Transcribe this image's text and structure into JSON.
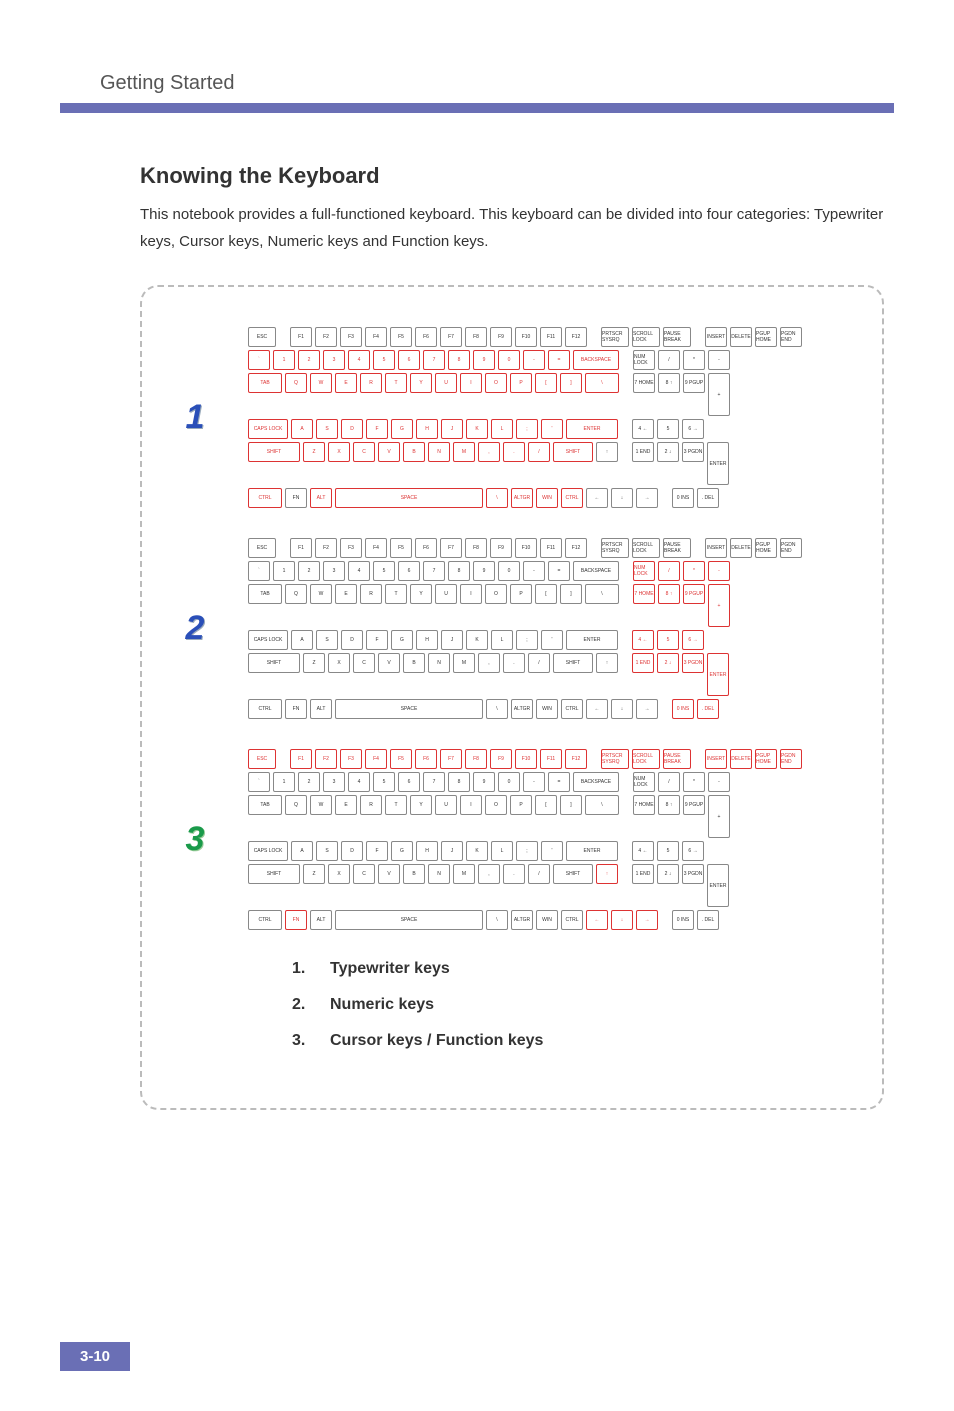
{
  "header": {
    "title": "Getting Started"
  },
  "section": {
    "title": "Knowing the Keyboard",
    "intro": "This notebook provides a full-functioned keyboard.    This keyboard can be divided into four categories: Typewriter keys, Cursor keys, Numeric keys and Function keys."
  },
  "diagrams": [
    {
      "number": "1",
      "color": "n1",
      "highlight": "typewriter"
    },
    {
      "number": "2",
      "color": "n2",
      "highlight": "numeric"
    },
    {
      "number": "3",
      "color": "n3",
      "highlight": "cursor_function"
    }
  ],
  "legend": [
    {
      "n": "1.",
      "label": "Typewriter keys"
    },
    {
      "n": "2.",
      "label": "Numeric keys"
    },
    {
      "n": "3.",
      "label": "Cursor keys / Function keys"
    }
  ],
  "keys": {
    "row_fn": [
      "ESC",
      "F1",
      "F2",
      "F3",
      "F4",
      "F5",
      "F6",
      "F7",
      "F8",
      "F9",
      "F10",
      "F11",
      "F12",
      "PRTSCR SYSRQ",
      "SCROLL LOCK",
      "PAUSE BREAK"
    ],
    "row_fn_right": [
      "INSERT",
      "DELETE",
      "PGUP HOME",
      "PGDN END"
    ],
    "row_num": [
      "`",
      "1",
      "2",
      "3",
      "4",
      "5",
      "6",
      "7",
      "8",
      "9",
      "0",
      "-",
      "=",
      "BACKSPACE"
    ],
    "row_num_right": [
      "NUM LOCK",
      "/",
      "*",
      "-"
    ],
    "row_q": [
      "TAB",
      "Q",
      "W",
      "E",
      "R",
      "T",
      "Y",
      "U",
      "I",
      "O",
      "P",
      "[",
      "]",
      "\\"
    ],
    "row_q_right": [
      "7 HOME",
      "8 ↑",
      "9 PGUP"
    ],
    "row_a": [
      "CAPS LOCK",
      "A",
      "S",
      "D",
      "F",
      "G",
      "H",
      "J",
      "K",
      "L",
      ";",
      "'",
      "ENTER"
    ],
    "row_a_right": [
      "4 ←",
      "5",
      "6 →"
    ],
    "row_z": [
      "SHIFT",
      "Z",
      "X",
      "C",
      "V",
      "B",
      "N",
      "M",
      ",",
      ".",
      "/",
      "SHIFT",
      "↑"
    ],
    "row_z_right": [
      "1 END",
      "2 ↓",
      "3 PGDN"
    ],
    "row_sp": [
      "CTRL",
      "FN",
      "ALT",
      "SPACE",
      "\\",
      "ALTGR",
      "WIN",
      "CTRL",
      "←",
      "↓",
      "→"
    ],
    "row_sp_right": [
      "0 INS",
      ". DEL"
    ],
    "plus": "+",
    "enter": "ENTER"
  },
  "page_number": "3-10"
}
